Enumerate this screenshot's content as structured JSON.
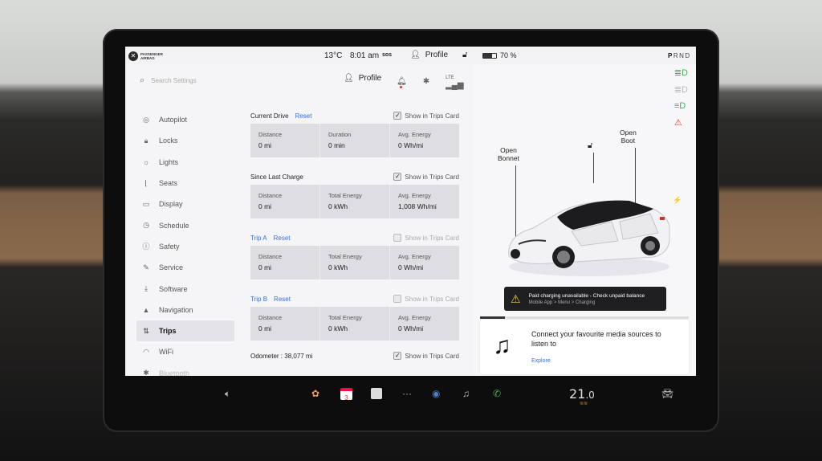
{
  "status": {
    "airbag_text": [
      "PASSENGER",
      "AIRBAG"
    ],
    "temp": "13°C",
    "time": "8:01 am",
    "sos": "sos",
    "profile": "Profile",
    "battery": "70 %",
    "battery_level": 0.7,
    "gear": {
      "P": "P",
      "R": "R",
      "N": "N",
      "D": "D"
    }
  },
  "settings": {
    "search_placeholder": "Search Settings",
    "profile": "Profile",
    "lte": "LTE",
    "sidebar": [
      {
        "label": "Autopilot",
        "icon": "steering-wheel-icon"
      },
      {
        "label": "Locks",
        "icon": "lock-icon"
      },
      {
        "label": "Lights",
        "icon": "light-icon"
      },
      {
        "label": "Seats",
        "icon": "seat-icon"
      },
      {
        "label": "Display",
        "icon": "display-icon"
      },
      {
        "label": "Schedule",
        "icon": "schedule-icon"
      },
      {
        "label": "Safety",
        "icon": "safety-icon"
      },
      {
        "label": "Service",
        "icon": "wrench-icon"
      },
      {
        "label": "Software",
        "icon": "download-icon"
      },
      {
        "label": "Navigation",
        "icon": "navigation-icon"
      },
      {
        "label": "Trips",
        "icon": "trips-icon"
      },
      {
        "label": "WiFi",
        "icon": "wifi-icon"
      },
      {
        "label": "Bluetooth",
        "icon": "bluetooth-icon"
      }
    ],
    "show_label": "Show in Trips Card",
    "current_drive": {
      "title": "Current Drive",
      "reset": "Reset",
      "show_checked": true,
      "c1_label": "Distance",
      "c1_value": "0 mi",
      "c2_label": "Duration",
      "c2_value": "0 min",
      "c3_label": "Avg. Energy",
      "c3_value": "0 Wh/mi"
    },
    "since_last_charge": {
      "title": "Since Last Charge",
      "show_checked": true,
      "c1_label": "Distance",
      "c1_value": "0 mi",
      "c2_label": "Total Energy",
      "c2_value": "0 kWh",
      "c3_label": "Avg. Energy",
      "c3_value": "1,008 Wh/mi"
    },
    "trip_a": {
      "title": "Trip A",
      "reset": "Reset",
      "show_checked": false,
      "c1_label": "Distance",
      "c1_value": "0 mi",
      "c2_label": "Total Energy",
      "c2_value": "0 kWh",
      "c3_label": "Avg. Energy",
      "c3_value": "0 Wh/mi"
    },
    "trip_b": {
      "title": "Trip B",
      "reset": "Reset",
      "show_checked": false,
      "c1_label": "Distance",
      "c1_value": "0 mi",
      "c2_label": "Total Energy",
      "c2_value": "0 kWh",
      "c3_label": "Avg. Energy",
      "c3_value": "0 Wh/mi"
    },
    "odometer_label": "Odometer :",
    "odometer_value": "38,077 mi",
    "odometer_show_checked": true
  },
  "car": {
    "open_bonnet": [
      "Open",
      "Bonnet"
    ],
    "open_boot": [
      "Open",
      "Boot"
    ],
    "alert_title": "Paid charging unavailable - Check unpaid balance",
    "alert_path": "Mobile App > Menu > Charging",
    "media_msg": "Connect your favourite media sources to listen to",
    "media_explore": "Explore",
    "indicators": [
      "headlight-icon",
      "parking-light-icon",
      "fog-light-icon",
      "seatbelt-warning-icon"
    ],
    "colors": {
      "green": "#3cb54a",
      "red": "#e03a2e",
      "blue": "#3a6fd8"
    }
  },
  "dock": {
    "calendar_day": "3",
    "temp_main": "21",
    "temp_dec": ".0"
  }
}
